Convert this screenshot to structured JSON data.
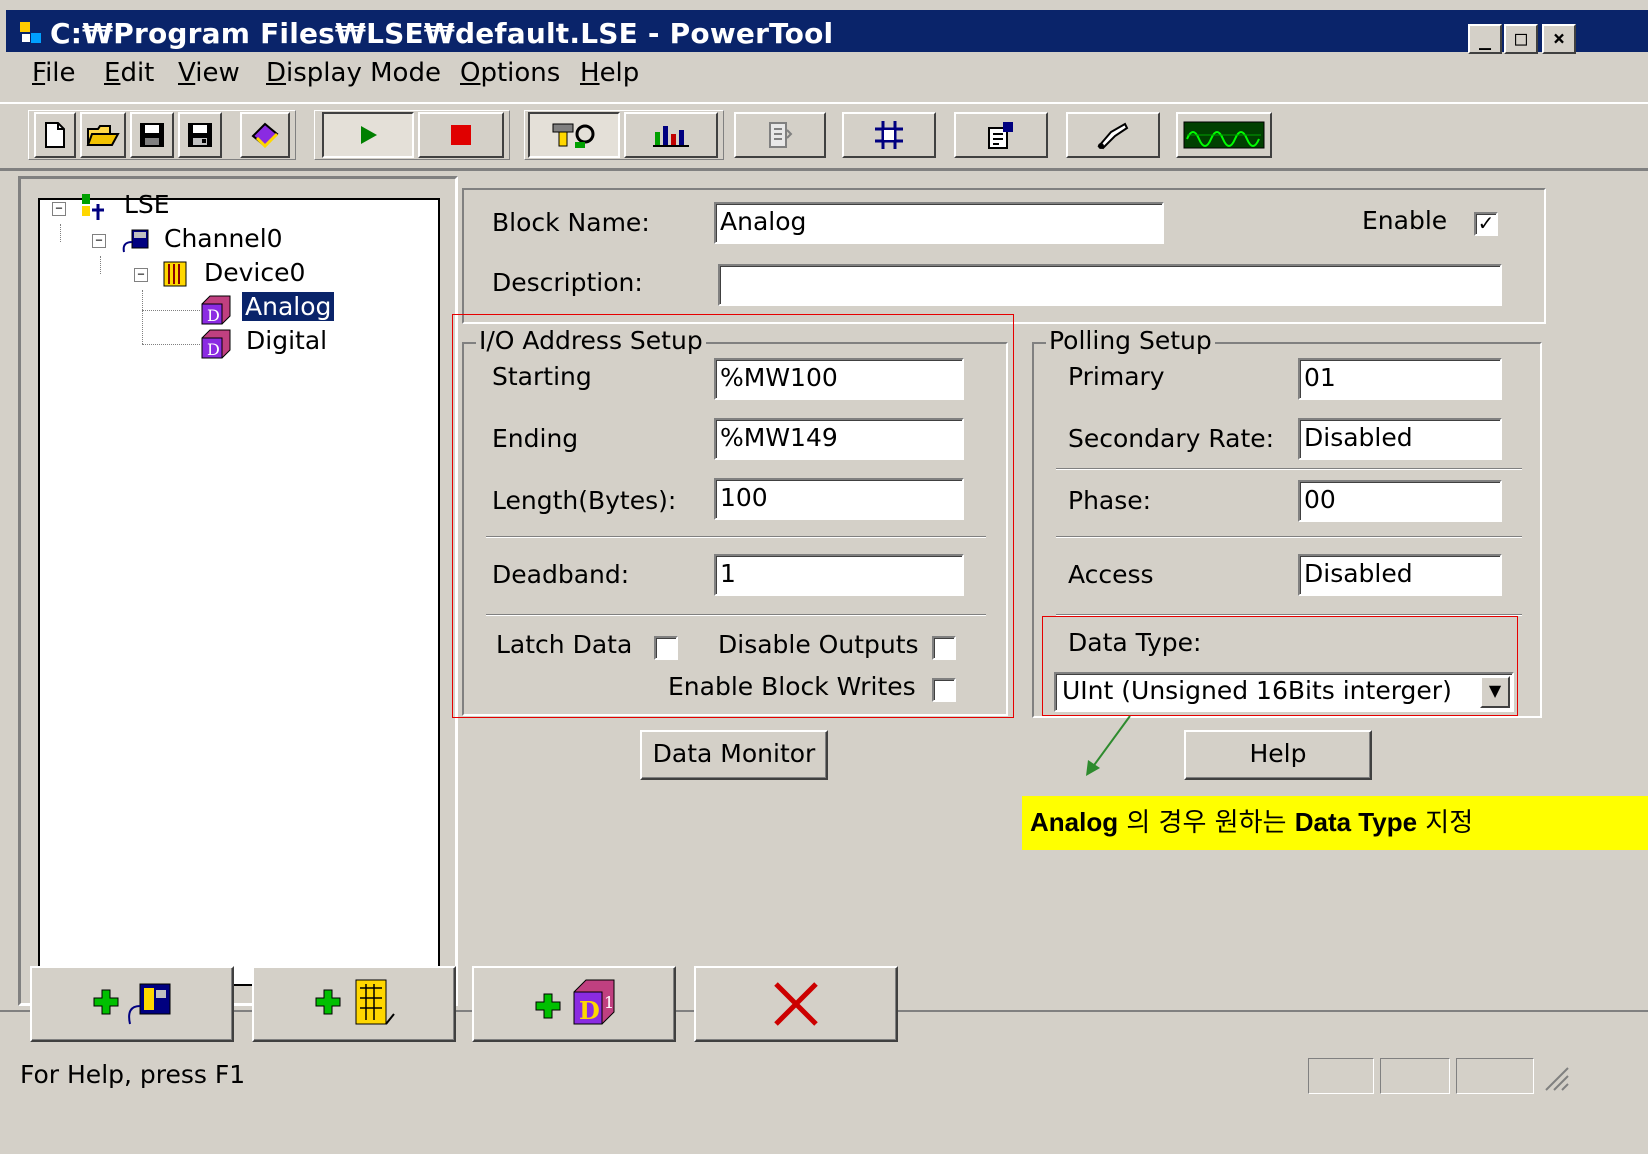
{
  "window": {
    "title": "C:₩Program Files₩LSE₩default.LSE - PowerTool",
    "minimize": "_",
    "maximize": "□",
    "close": "×"
  },
  "menu": [
    {
      "label": "File",
      "accel": "F",
      "rest": "ile"
    },
    {
      "label": "Edit",
      "accel": "E",
      "rest": "dit"
    },
    {
      "label": "View",
      "accel": "V",
      "rest": "iew"
    },
    {
      "label": "Display Mode",
      "accel": "D",
      "rest": "isplay Mode"
    },
    {
      "label": "Options",
      "accel": "O",
      "rest": "ptions"
    },
    {
      "label": "Help",
      "accel": "H",
      "rest": "elp"
    }
  ],
  "toolbar": {
    "icons": [
      "new-file-icon",
      "open-folder-icon",
      "save-icon",
      "save-as-icon",
      "help-book-icon",
      "run-icon",
      "stop-icon",
      "settings-tools-icon",
      "bar-chart-icon",
      "properties-icon",
      "network-icon",
      "document-settings-icon",
      "probe-icon",
      "waveform-icon"
    ]
  },
  "tree": {
    "root": "LSE",
    "channel": "Channel0",
    "device": "Device0",
    "blocks": [
      "Analog",
      "Digital"
    ],
    "selected": "Analog"
  },
  "form": {
    "block_name_label": "Block Name:",
    "block_name_value": "Analog",
    "enable_label": "Enable",
    "enable_checked": "✓",
    "description_label": "Description:",
    "description_value": "",
    "io_group_title": "I/O Address Setup",
    "starting_label": "Starting",
    "starting_value": "%MW100",
    "ending_label": "Ending",
    "ending_value": "%MW149",
    "length_label": "Length(Bytes):",
    "length_value": "100",
    "deadband_label": "Deadband:",
    "deadband_value": "1",
    "latch_label": "Latch Data",
    "disable_outputs_label": "Disable Outputs",
    "enable_block_writes_label": "Enable Block Writes",
    "polling_group_title": "Polling Setup",
    "primary_label": "Primary",
    "primary_value": "01",
    "secondary_label": "Secondary Rate:",
    "secondary_value": "Disabled",
    "phase_label": "Phase:",
    "phase_value": "00",
    "access_label": "Access",
    "access_value": "Disabled",
    "data_type_label": "Data Type:",
    "data_type_value": "UInt  (Unsigned 16Bits interger)",
    "data_monitor_button": "Data Monitor",
    "help_button": "Help"
  },
  "annotation": {
    "part1": "Analog",
    "part2": " 의 경우 원하는 ",
    "part3": "Data Type",
    "part4": " 지정"
  },
  "bottom_toolbar": {
    "icons": [
      "add-channel-icon",
      "add-device-icon",
      "add-block-icon",
      "delete-icon"
    ]
  },
  "status": {
    "text": "For Help, press F1"
  },
  "colors": {
    "face": "#d4d0c8",
    "title_bar": "#0a246a",
    "selection": "#0a246a",
    "highlight_box": "#e60000",
    "annotation_bg": "#ffff00",
    "arrow": "#2e8b2e"
  }
}
